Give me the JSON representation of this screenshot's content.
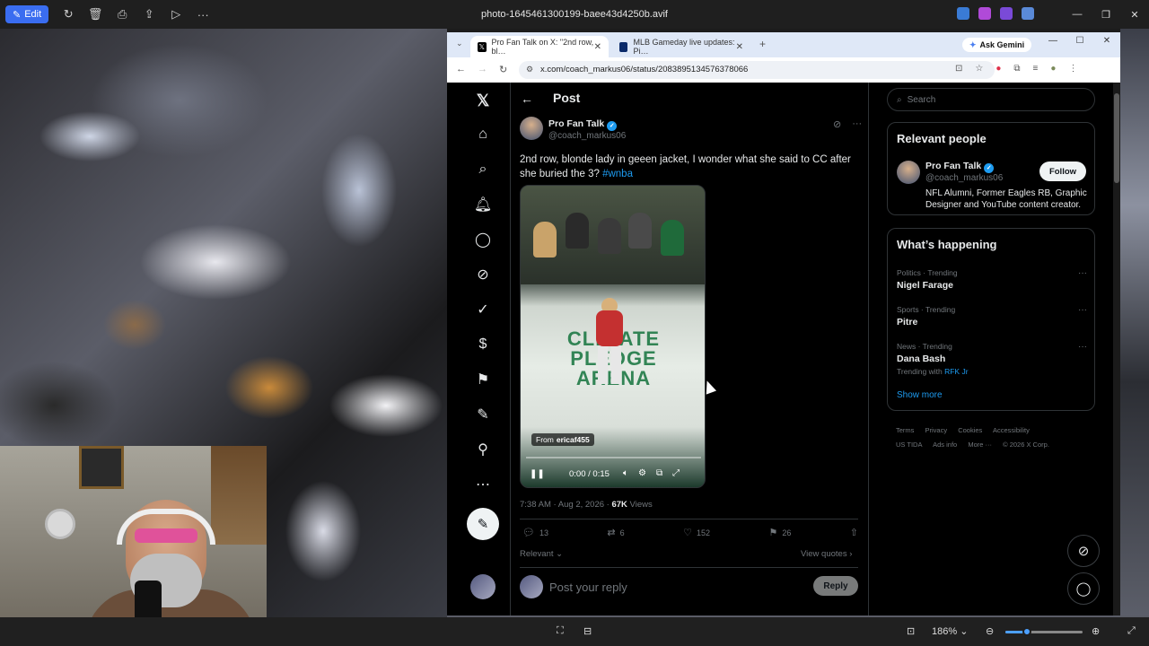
{
  "photos_app": {
    "edit_label": "Edit",
    "file_title": "photo-1645461300199-baee43d4250b.avif",
    "zoom_level": "186%",
    "zoom_fraction": 0.28
  },
  "browser": {
    "tabs": [
      {
        "title": "Pro Fan Talk on X: \"2nd row, bl…",
        "active": true
      },
      {
        "title": "MLB Gameday live updates: Pi…",
        "active": false
      }
    ],
    "gemini_label": "Ask Gemini",
    "url": "x.com/coach_markus06/status/2083895134576378066"
  },
  "x": {
    "header_title": "Post",
    "author": {
      "name": "Pro Fan Talk",
      "handle": "@coach_markus06"
    },
    "post_text": "2nd row, blonde lady in geeen jacket, I wonder what she said to CC after she buried the 3?",
    "hashtag": "#wnba",
    "video": {
      "court_text_1": "CLIMATE",
      "court_text_2": "PLEDGE",
      "court_text_3": "ARENA",
      "from_label": "From",
      "from_user": "ericaf455",
      "time": "0:00 / 0:15"
    },
    "meta": {
      "time": "7:38 AM · Aug 2, 2026 · ",
      "views": "67K",
      "views_label": " Views"
    },
    "actions": {
      "replies": "13",
      "reposts": "6",
      "likes": "152",
      "bookmarks": "26"
    },
    "relevant_label": "Relevant",
    "view_quotes_label": "View quotes",
    "reply_placeholder": "Post your reply",
    "reply_button": "Reply",
    "search_placeholder": "Search",
    "relevant_people": {
      "title": "Relevant people",
      "name": "Pro Fan Talk",
      "handle": "@coach_markus06",
      "bio": "NFL Alumni, Former Eagles RB, Graphic Designer and YouTube content creator.",
      "follow": "Follow"
    },
    "whats_happening": {
      "title": "What’s happening",
      "trends": [
        {
          "category": "Politics · Trending",
          "name": "Nigel Farage"
        },
        {
          "category": "Sports · Trending",
          "name": "Pitre"
        },
        {
          "category": "News · Trending",
          "name": "Dana Bash",
          "sub": "Trending with ",
          "sub_link": "RFK Jr"
        }
      ],
      "show_more": "Show more"
    },
    "footer": [
      "Terms",
      "Privacy",
      "Cookies",
      "Accessibility",
      "US TIDA",
      "Ads info",
      "More ···",
      "© 2026 X Corp."
    ]
  },
  "colors": {
    "accent": "#1d9bf0",
    "background": "#000000",
    "photos_accent": "#3a6df0"
  }
}
